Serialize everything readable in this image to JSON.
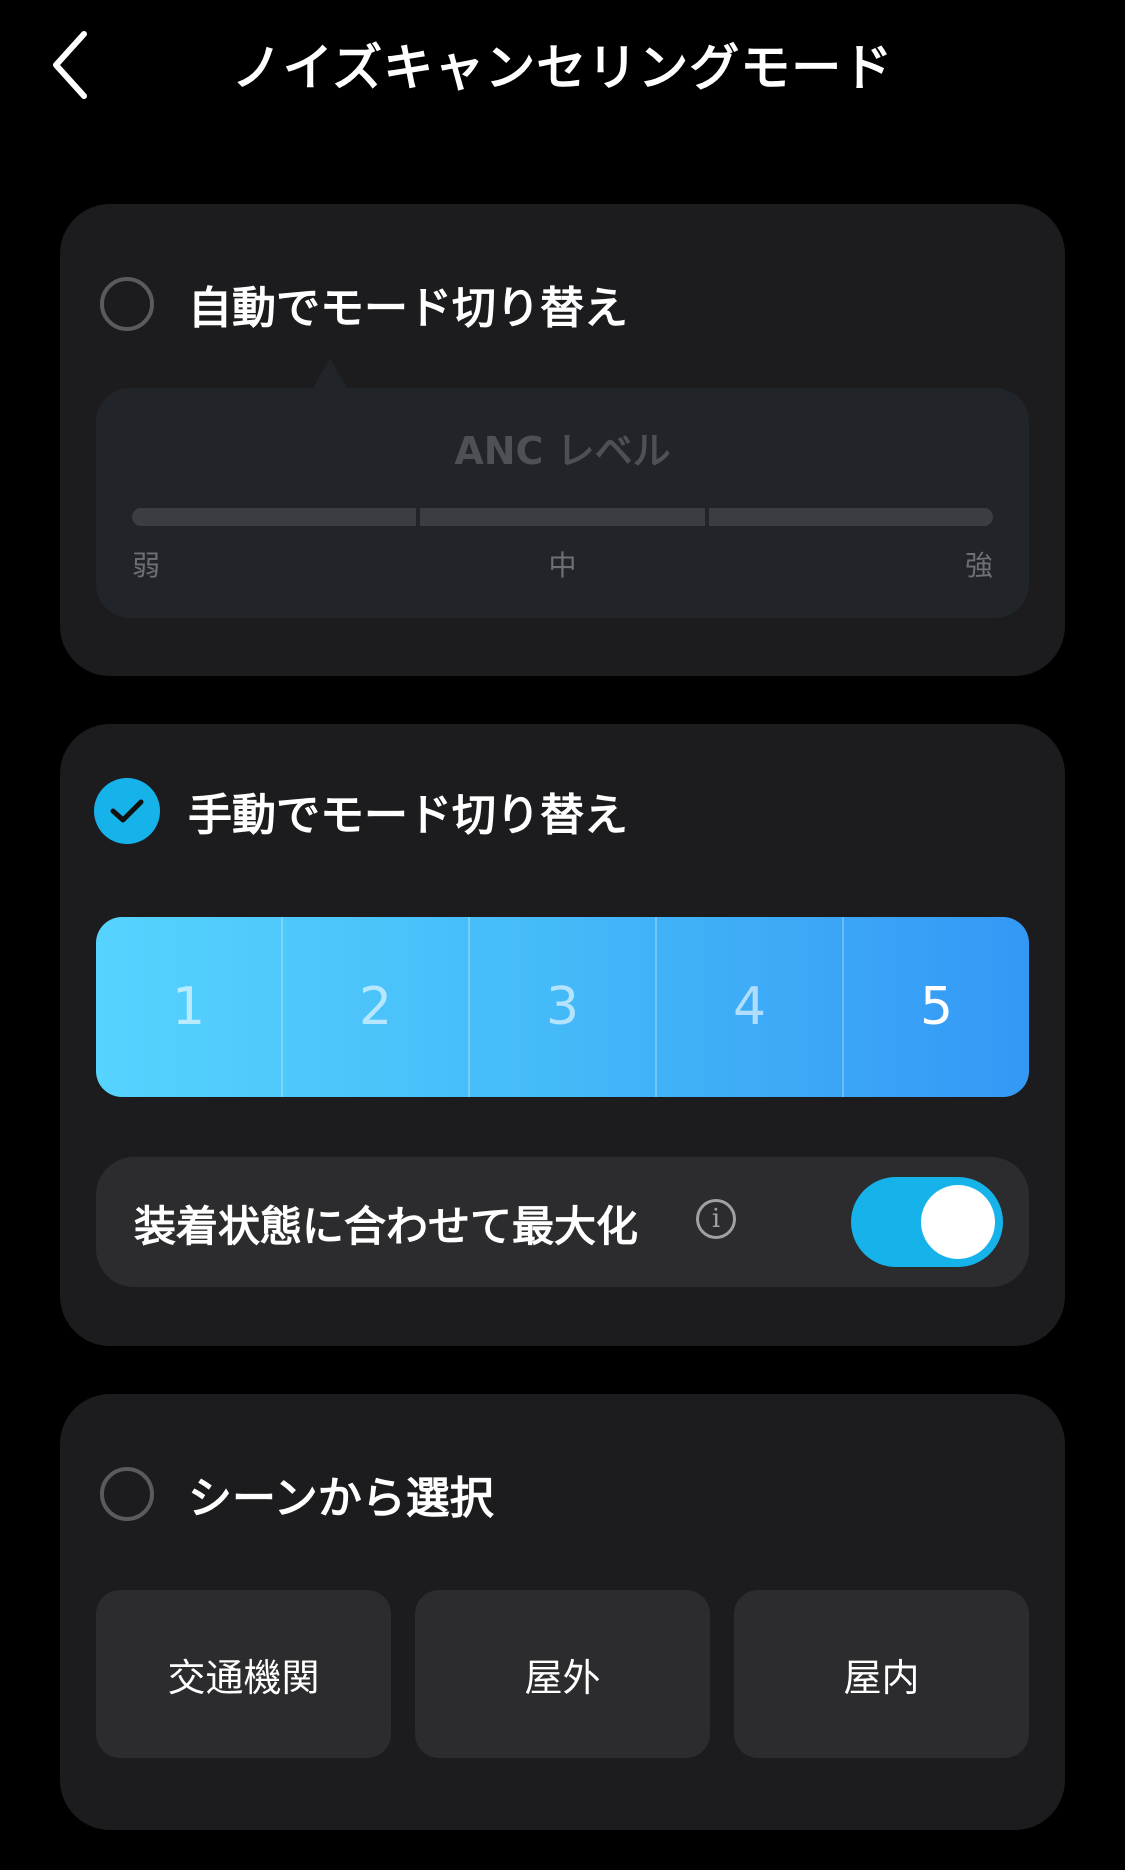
{
  "header": {
    "title": "ノイズキャンセリングモード",
    "back_icon": "chevron-left-icon"
  },
  "auto_mode": {
    "label": "自動でモード切り替え",
    "selected": false,
    "anc_panel": {
      "title": "ANC レベル",
      "segments": 3,
      "labels": [
        "弱",
        "中",
        "強"
      ]
    }
  },
  "manual_mode": {
    "label": "手動でモード切り替え",
    "selected": true,
    "levels": [
      "1",
      "2",
      "3",
      "4",
      "5"
    ],
    "selected_level": "5",
    "optimize": {
      "label": "装着状態に合わせて最大化",
      "info_icon": "info-icon",
      "enabled": true
    }
  },
  "scene_mode": {
    "label": "シーンから選択",
    "selected": false,
    "scenes": [
      "交通機関",
      "屋外",
      "屋内"
    ]
  },
  "colors": {
    "accent": "#16b3ea",
    "background": "#000000",
    "card": "#1c1c1e",
    "gradient_start": "#56d3fe",
    "gradient_end": "#3498f5"
  }
}
